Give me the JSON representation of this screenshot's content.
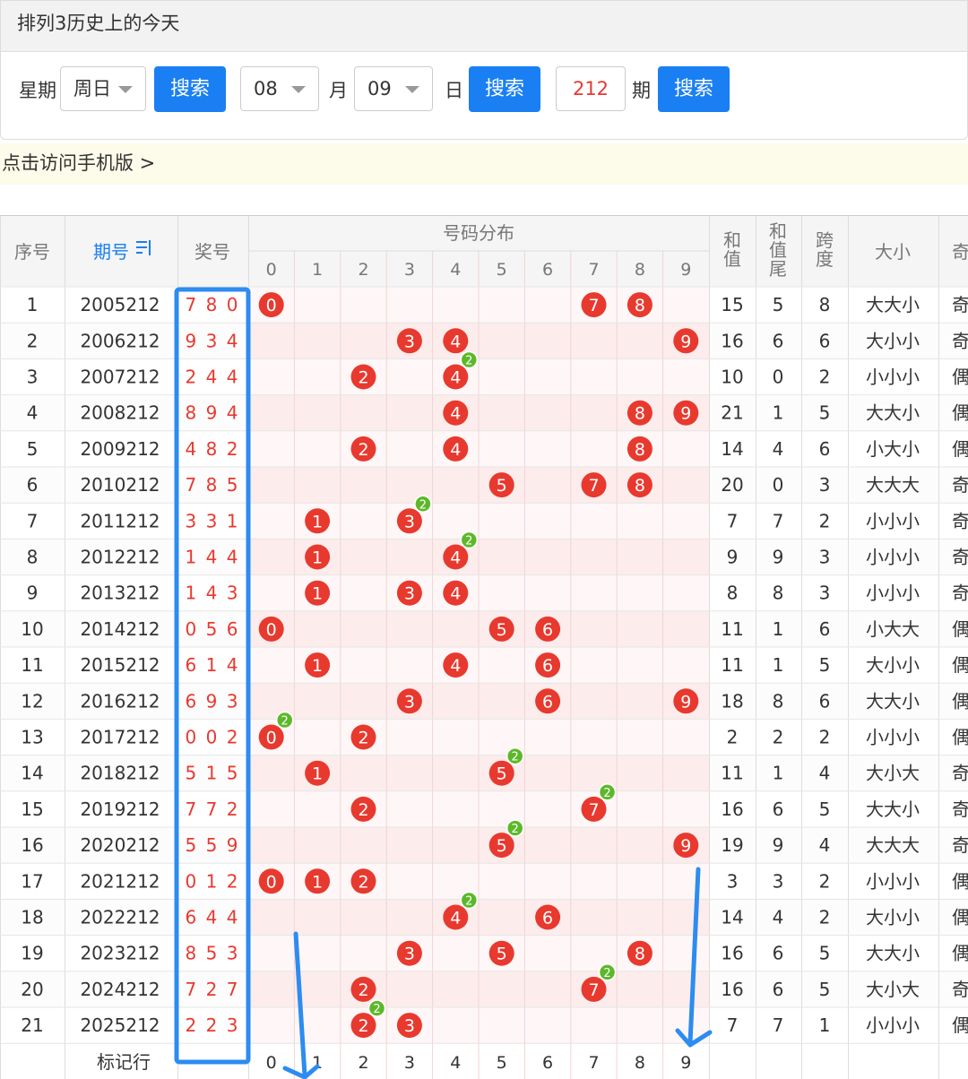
{
  "title": "排列3历史上的今天",
  "search": {
    "weekday_label": "星期",
    "weekday_value": "周日",
    "search_label": "搜索",
    "month_value": "08",
    "month_label": "月",
    "day_value": "09",
    "day_label": "日",
    "period_value": "212",
    "period_label": "期"
  },
  "mobile_link": "点击访问手机版 >",
  "table": {
    "headers": {
      "seq": "序号",
      "issue": "期号",
      "issue_icon": "sort-icon",
      "prize": "奖号",
      "dist": "号码分布",
      "sum": "和值",
      "sum_tail": "和值尾",
      "span": "跨度",
      "size": "大小",
      "parity_partial": "奇"
    },
    "digits": [
      "0",
      "1",
      "2",
      "3",
      "4",
      "5",
      "6",
      "7",
      "8",
      "9"
    ],
    "rows": [
      {
        "seq": "1",
        "issue": "2005212",
        "prize": "7 8 0",
        "sum": "15",
        "tail": "5",
        "span": "8",
        "size": "大大小",
        "parity": "奇"
      },
      {
        "seq": "2",
        "issue": "2006212",
        "prize": "9 3 4",
        "sum": "16",
        "tail": "6",
        "span": "6",
        "size": "大小小",
        "parity": "奇"
      },
      {
        "seq": "3",
        "issue": "2007212",
        "prize": "2 4 4",
        "sum": "10",
        "tail": "0",
        "span": "2",
        "size": "小小小",
        "parity": "偶"
      },
      {
        "seq": "4",
        "issue": "2008212",
        "prize": "8 9 4",
        "sum": "21",
        "tail": "1",
        "span": "5",
        "size": "大大小",
        "parity": "偶"
      },
      {
        "seq": "5",
        "issue": "2009212",
        "prize": "4 8 2",
        "sum": "14",
        "tail": "4",
        "span": "6",
        "size": "小大小",
        "parity": "偶"
      },
      {
        "seq": "6",
        "issue": "2010212",
        "prize": "7 8 5",
        "sum": "20",
        "tail": "0",
        "span": "3",
        "size": "大大大",
        "parity": "奇"
      },
      {
        "seq": "7",
        "issue": "2011212",
        "prize": "3 3 1",
        "sum": "7",
        "tail": "7",
        "span": "2",
        "size": "小小小",
        "parity": "奇"
      },
      {
        "seq": "8",
        "issue": "2012212",
        "prize": "1 4 4",
        "sum": "9",
        "tail": "9",
        "span": "3",
        "size": "小小小",
        "parity": "奇"
      },
      {
        "seq": "9",
        "issue": "2013212",
        "prize": "1 4 3",
        "sum": "8",
        "tail": "8",
        "span": "3",
        "size": "小小小",
        "parity": "奇"
      },
      {
        "seq": "10",
        "issue": "2014212",
        "prize": "0 5 6",
        "sum": "11",
        "tail": "1",
        "span": "6",
        "size": "小大大",
        "parity": "偶"
      },
      {
        "seq": "11",
        "issue": "2015212",
        "prize": "6 1 4",
        "sum": "11",
        "tail": "1",
        "span": "5",
        "size": "大小小",
        "parity": "偶"
      },
      {
        "seq": "12",
        "issue": "2016212",
        "prize": "6 9 3",
        "sum": "18",
        "tail": "8",
        "span": "6",
        "size": "大大小",
        "parity": "偶"
      },
      {
        "seq": "13",
        "issue": "2017212",
        "prize": "0 0 2",
        "sum": "2",
        "tail": "2",
        "span": "2",
        "size": "小小小",
        "parity": "偶"
      },
      {
        "seq": "14",
        "issue": "2018212",
        "prize": "5 1 5",
        "sum": "11",
        "tail": "1",
        "span": "4",
        "size": "大小大",
        "parity": "奇"
      },
      {
        "seq": "15",
        "issue": "2019212",
        "prize": "7 7 2",
        "sum": "16",
        "tail": "6",
        "span": "5",
        "size": "大大小",
        "parity": "奇"
      },
      {
        "seq": "16",
        "issue": "2020212",
        "prize": "5 5 9",
        "sum": "19",
        "tail": "9",
        "span": "4",
        "size": "大大大",
        "parity": "奇"
      },
      {
        "seq": "17",
        "issue": "2021212",
        "prize": "0 1 2",
        "sum": "3",
        "tail": "3",
        "span": "2",
        "size": "小小小",
        "parity": "偶"
      },
      {
        "seq": "18",
        "issue": "2022212",
        "prize": "6 4 4",
        "sum": "14",
        "tail": "4",
        "span": "2",
        "size": "大小小",
        "parity": "偶"
      },
      {
        "seq": "19",
        "issue": "2023212",
        "prize": "8 5 3",
        "sum": "16",
        "tail": "6",
        "span": "5",
        "size": "大大小",
        "parity": "偶"
      },
      {
        "seq": "20",
        "issue": "2024212",
        "prize": "7 2 7",
        "sum": "16",
        "tail": "6",
        "span": "5",
        "size": "大小大",
        "parity": "奇"
      },
      {
        "seq": "21",
        "issue": "2025212",
        "prize": "2 2 3",
        "sum": "7",
        "tail": "7",
        "span": "1",
        "size": "小小小",
        "parity": "偶"
      }
    ],
    "footer_label": "标记行"
  },
  "colors": {
    "ball": "#e8392f",
    "repeat_badge": "#5cb82a",
    "link_blue": "#1a7ff2",
    "annotation_blue": "#2d8cf0",
    "stripe_pink": "#fdecec",
    "stripe_light": "#fff7f7"
  }
}
